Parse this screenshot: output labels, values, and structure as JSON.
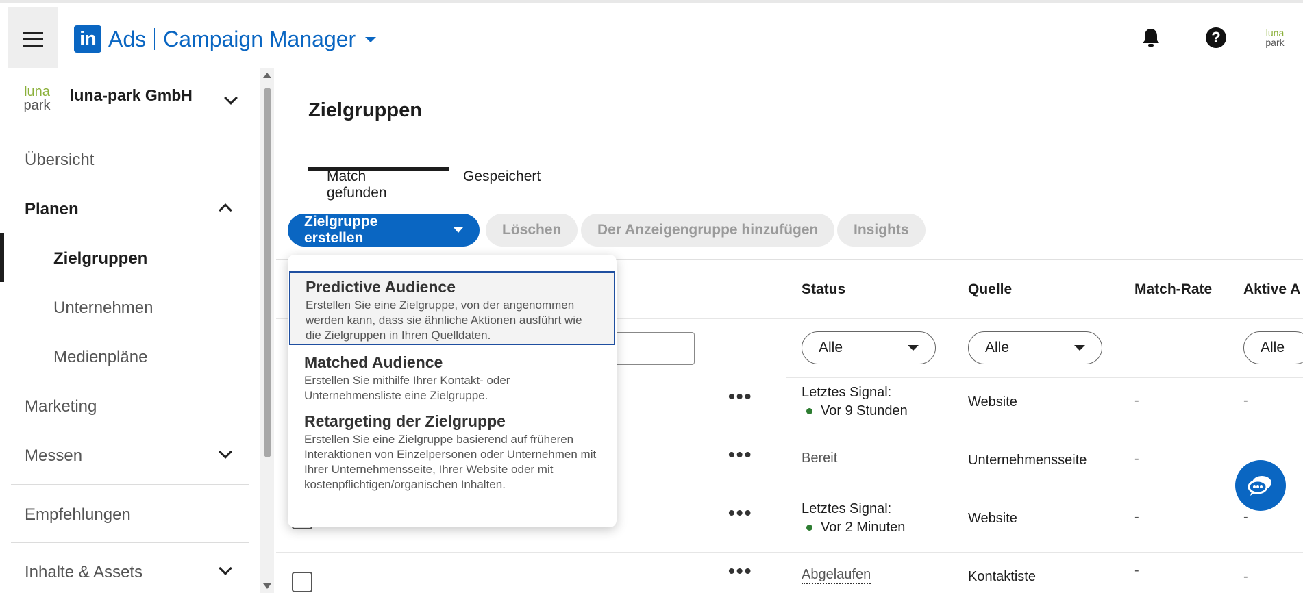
{
  "header": {
    "brand_logo": "in",
    "brand_ads": "Ads",
    "brand_product": "Campaign Manager",
    "icons": [
      "menu-icon",
      "bell-icon",
      "help-icon",
      "account-avatar"
    ],
    "account_logo_line1": "luna",
    "account_logo_line2": "park"
  },
  "sidebar": {
    "org_logo_line1": "luna",
    "org_logo_line2": "park",
    "org_name": "luna-park GmbH",
    "items": [
      {
        "label": "Übersicht"
      },
      {
        "label": "Planen"
      },
      {
        "label": "Zielgruppen"
      },
      {
        "label": "Unternehmen"
      },
      {
        "label": "Medienpläne"
      },
      {
        "label": "Marketing"
      },
      {
        "label": "Messen"
      },
      {
        "label": "Empfehlungen"
      },
      {
        "label": "Inhalte & Assets"
      }
    ]
  },
  "main": {
    "title": "Zielgruppen",
    "tabs": [
      {
        "label": "Match gefunden",
        "active": true
      },
      {
        "label": "Gespeichert",
        "active": false
      }
    ],
    "toolbar": {
      "create": "Zielgruppe erstellen",
      "delete": "Löschen",
      "add_to_group": "Der Anzeigengruppe hinzufügen",
      "insights": "Insights"
    },
    "table": {
      "headers": {
        "status": "Status",
        "source": "Quelle",
        "match_rate": "Match-Rate",
        "active": "Aktive A"
      },
      "filters": {
        "status": "Alle",
        "source": "Alle",
        "active": "Alle"
      },
      "rows": [
        {
          "status_line1": "Letztes Signal:",
          "status_line2": "Vor 9 Stunden",
          "source": "Website",
          "match_rate": "-",
          "active": "-"
        },
        {
          "status_line1": "Bereit",
          "status_line2": "",
          "source": "Unternehmensseite",
          "match_rate": "-",
          "active": ""
        },
        {
          "status_line1": "Letztes Signal:",
          "status_line2": "Vor 2 Minuten",
          "source": "Website",
          "match_rate": "-",
          "active": "-"
        },
        {
          "status_line1": "Abgelaufen",
          "status_line2": "",
          "source": "Kontaktiste",
          "match_rate": "-",
          "active": "-"
        }
      ],
      "row_menu": "•••"
    }
  },
  "dropdown": {
    "items": [
      {
        "title": "Predictive Audience",
        "desc": "Erstellen Sie eine Zielgruppe, von der angenommen werden kann, dass sie ähnliche Aktionen ausführt wie die Zielgruppen in Ihren Quelldaten.",
        "selected": true
      },
      {
        "title": "Matched Audience",
        "desc": "Erstellen Sie mithilfe Ihrer Kontakt- oder Unternehmensliste eine Zielgruppe.",
        "selected": false
      },
      {
        "title": "Retargeting der Zielgruppe",
        "desc": "Erstellen Sie eine Zielgruppe basierend auf früheren Interaktionen von Einzelpersonen oder Unternehmen mit Ihrer Unternehmensseite, Ihrer Website oder mit kostenpflichtigen/organischen Inhalten.",
        "selected": false
      }
    ]
  },
  "colors": {
    "brand_blue": "#0a66c2",
    "status_green": "#2e7d32",
    "selected_border": "#1f4fa0"
  }
}
